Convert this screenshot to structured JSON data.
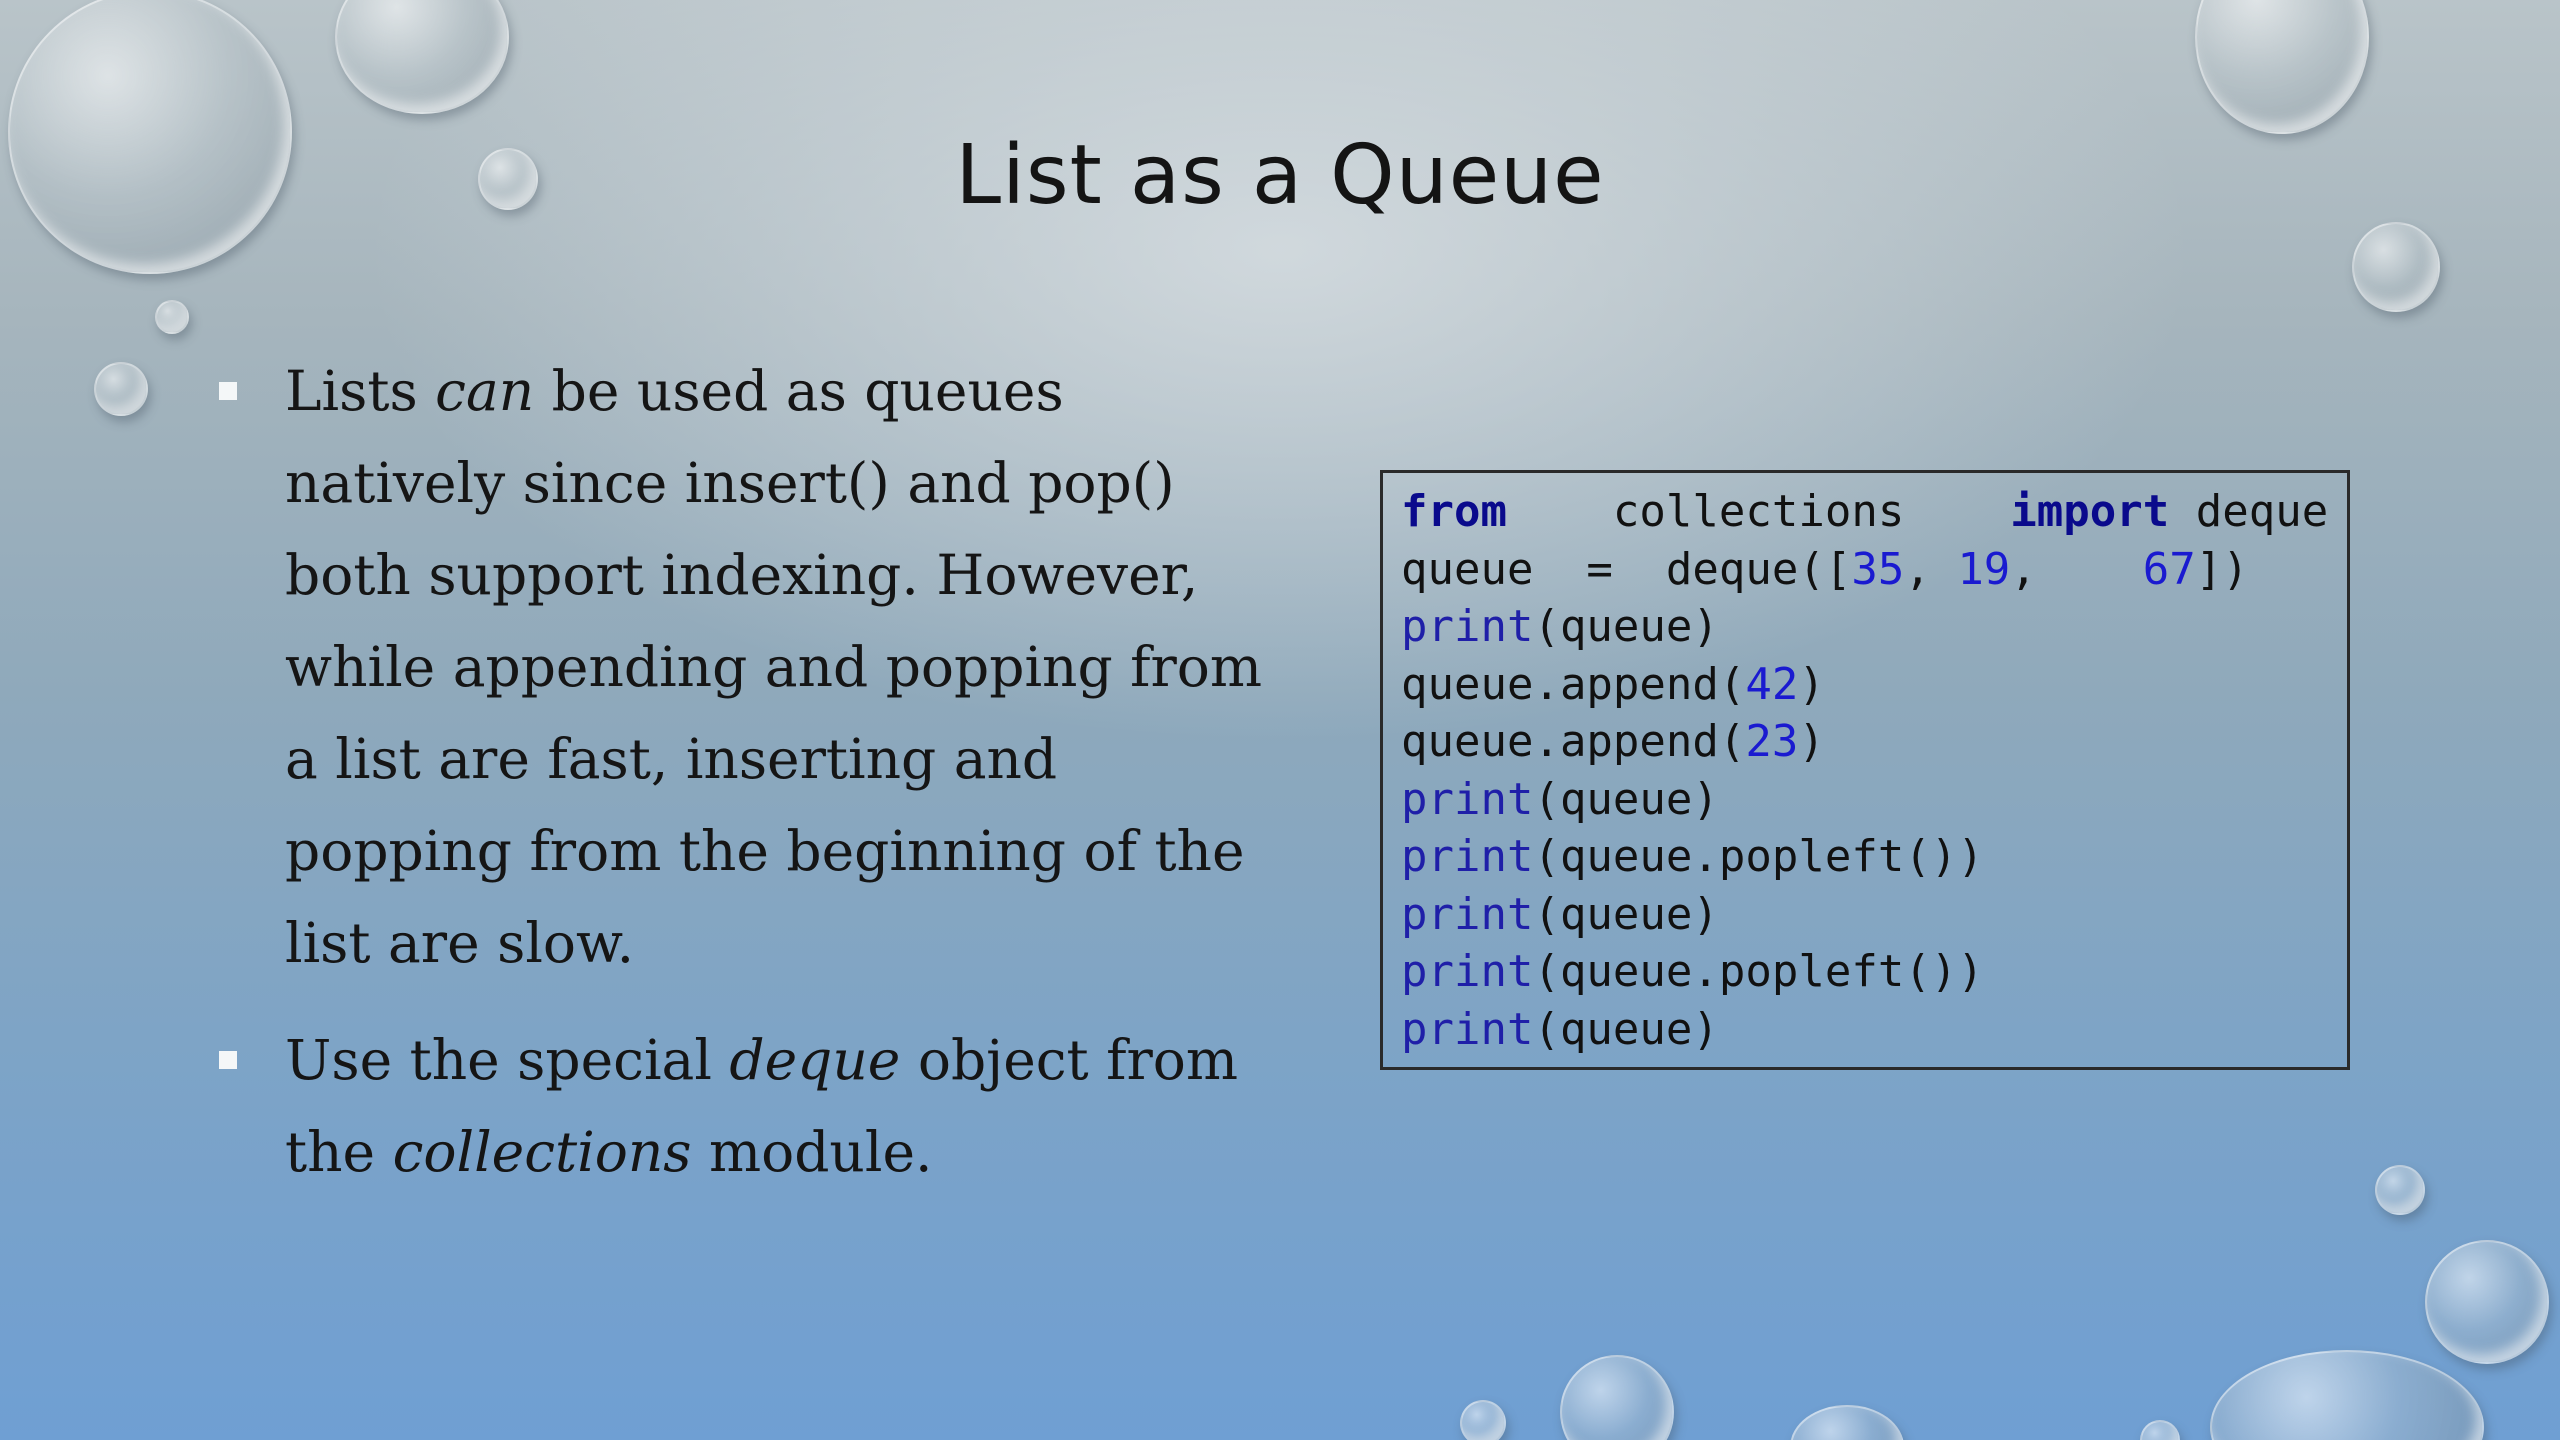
{
  "slide": {
    "title": "List as a Queue",
    "bullets": [
      {
        "parts": [
          {
            "text": "Lists ",
            "italic": false
          },
          {
            "text": "can",
            "italic": true
          },
          {
            "text": " be used as queues natively since insert() and pop() both support indexing. However, while appending and popping from a list are fast, inserting and popping from the beginning of the list are slow.",
            "italic": false
          }
        ]
      },
      {
        "parts": [
          {
            "text": "Use the special ",
            "italic": false
          },
          {
            "text": "deque",
            "italic": true
          },
          {
            "text": " object from the ",
            "italic": false
          },
          {
            "text": "collections",
            "italic": true
          },
          {
            "text": " module.",
            "italic": false
          }
        ]
      }
    ],
    "code": [
      [
        {
          "t": "from",
          "c": "kw"
        },
        {
          "t": "    collections    ",
          "c": ""
        },
        {
          "t": "import",
          "c": "kw"
        },
        {
          "t": " deque",
          "c": ""
        }
      ],
      [
        {
          "t": "queue  =  deque([",
          "c": ""
        },
        {
          "t": "35",
          "c": "num"
        },
        {
          "t": ", ",
          "c": ""
        },
        {
          "t": "19",
          "c": "num"
        },
        {
          "t": ",    ",
          "c": ""
        },
        {
          "t": "67",
          "c": "num"
        },
        {
          "t": "])",
          "c": ""
        }
      ],
      [
        {
          "t": "print",
          "c": "fn"
        },
        {
          "t": "(queue)",
          "c": ""
        }
      ],
      [
        {
          "t": "queue.append(",
          "c": ""
        },
        {
          "t": "42",
          "c": "num"
        },
        {
          "t": ")",
          "c": ""
        }
      ],
      [
        {
          "t": "queue.append(",
          "c": ""
        },
        {
          "t": "23",
          "c": "num"
        },
        {
          "t": ")",
          "c": ""
        }
      ],
      [
        {
          "t": "print",
          "c": "fn"
        },
        {
          "t": "(queue)",
          "c": ""
        }
      ],
      [
        {
          "t": "print",
          "c": "fn"
        },
        {
          "t": "(queue.popleft())",
          "c": ""
        }
      ],
      [
        {
          "t": "print",
          "c": "fn"
        },
        {
          "t": "(queue)",
          "c": ""
        }
      ],
      [
        {
          "t": "print",
          "c": "fn"
        },
        {
          "t": "(queue.popleft())",
          "c": ""
        }
      ],
      [
        {
          "t": "print",
          "c": "fn"
        },
        {
          "t": "(queue)",
          "c": ""
        }
      ]
    ]
  },
  "colors": {
    "keyword": "#0a0a8c",
    "builtin": "#1f1fa8",
    "number": "#1a1ad0",
    "text": "#111111"
  }
}
